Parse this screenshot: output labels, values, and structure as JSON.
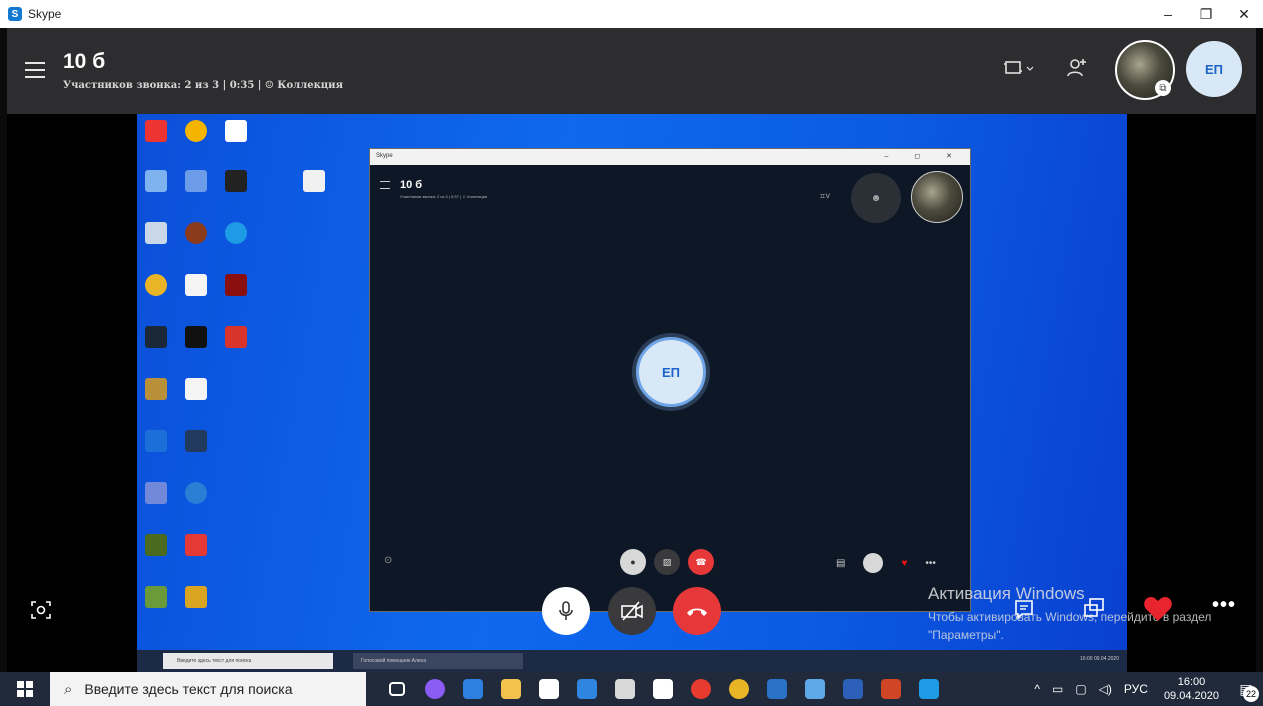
{
  "window": {
    "app_title": "Skype",
    "logo_letter": "S",
    "minimize_glyph": "–",
    "restore_glyph": "❐",
    "close_glyph": "✕"
  },
  "call": {
    "title": "10 б",
    "subtitle": "Участников звонка: 2 из 3 | 0:35 | ☺ Коллекция",
    "self_badge_icon": "screen-share-icon",
    "participant_initials": "ЕП"
  },
  "inner_window": {
    "title": "Skype",
    "controls": "–  ◻  ✕",
    "call_title": "10 б",
    "call_subtitle": "Участников звонка: 2 из 3 | 0:37 | ☺ Коллекция",
    "participant_initials": "ЕП",
    "taskbar_search": "Введите здесь текст для поиска",
    "taskbar_assistant": "Голосовой помощник Алиса",
    "tray": "16:00 09.04.2020"
  },
  "watermark": {
    "title": "Активация Windows",
    "text": "Чтобы активировать Windows, перейдите в раздел \"Параметры\"."
  },
  "controls": {
    "mic": "microphone-icon",
    "camera": "camera-off-icon",
    "end": "end-call-icon",
    "more": "•••"
  },
  "taskbar": {
    "search_placeholder": "Введите здесь текст для поиска",
    "language": "РУС",
    "time": "16:00",
    "date": "09.04.2020",
    "notifications": "22",
    "apps": [
      {
        "name": "task-view",
        "color": "#202a3a"
      },
      {
        "name": "alisa",
        "color": "#8a5cf5"
      },
      {
        "name": "edge",
        "color": "#2d7fe0"
      },
      {
        "name": "explorer",
        "color": "#f2c14e"
      },
      {
        "name": "store",
        "color": "#ffffff"
      },
      {
        "name": "mail",
        "color": "#2f86e0"
      },
      {
        "name": "paint",
        "color": "#d8d8d8"
      },
      {
        "name": "yandex-browser",
        "color": "#ffffff"
      },
      {
        "name": "yandex",
        "color": "#e63b2e"
      },
      {
        "name": "chrome",
        "color": "#e9b526"
      },
      {
        "name": "outlook",
        "color": "#2a72c5"
      },
      {
        "name": "photos",
        "color": "#5fa8e8"
      },
      {
        "name": "word",
        "color": "#2b5fb8"
      },
      {
        "name": "powerpoint",
        "color": "#d04526"
      },
      {
        "name": "skype",
        "color": "#1d9ce5"
      }
    ]
  }
}
